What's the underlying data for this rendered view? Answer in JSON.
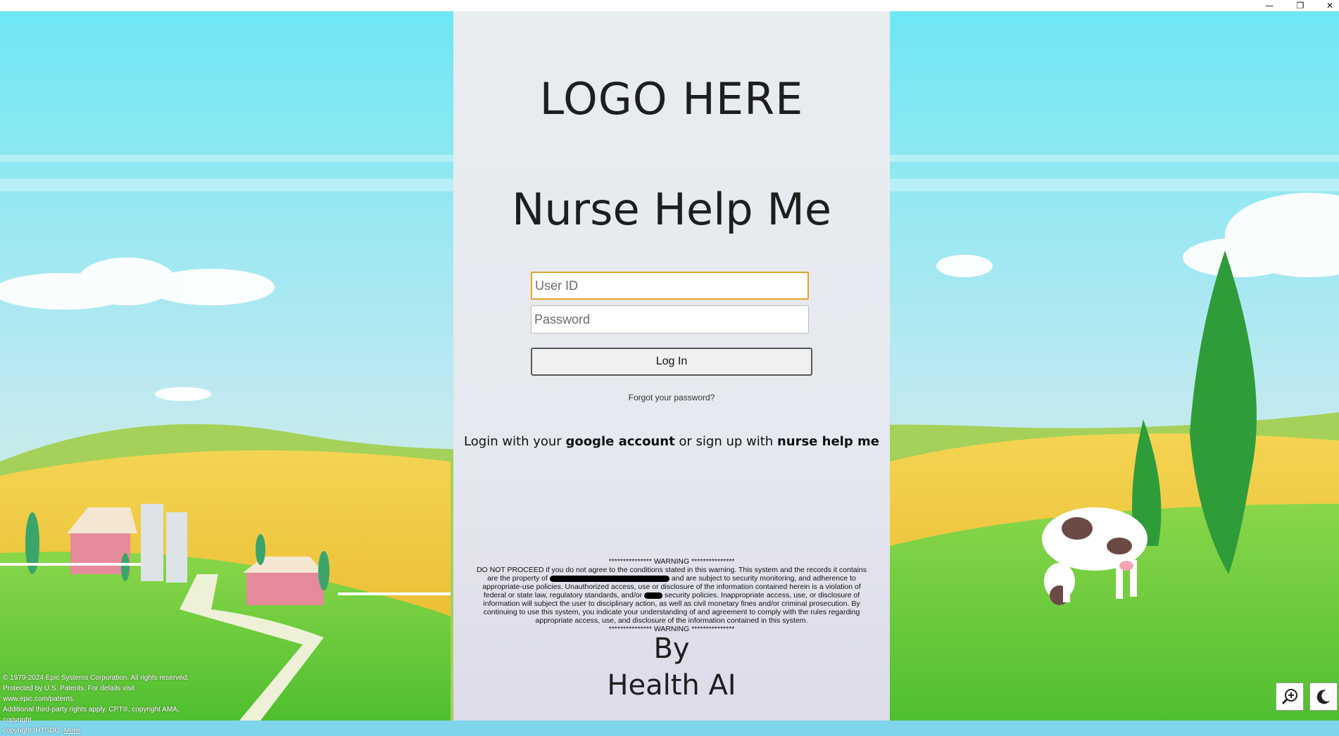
{
  "window": {
    "minimize_icon": "minimize-icon",
    "restore_icon": "restore-icon",
    "close_icon": "close-icon"
  },
  "login": {
    "logo_text": "LOGO HERE",
    "app_title": "Nurse Help Me",
    "user_id": {
      "value": "",
      "placeholder": "User ID"
    },
    "password": {
      "value": "",
      "placeholder": "Password"
    },
    "login_button": "Log In",
    "forgot_link": "Forgot your password?",
    "social": {
      "prefix": "Login with your ",
      "google": "google account",
      "middle": " or sign up with ",
      "signup": "nurse help me"
    },
    "warning": {
      "header": "*************** WARNING ***************",
      "line1": "DO NOT PROCEED if you do not agree to the conditions stated in this warning. This system and the records it contains",
      "line2a": "are the property of",
      "line2b": "and are subject to security monitoring, and adherence to",
      "line3": "appropriate-use policies. Unauthorized access, use or disclosure of the information contained herein is a violation of",
      "line4a": "federal or state law, regulatory standards, and/or",
      "line4b": "security policies. Inappropriate access, use, or disclosure of",
      "line5": "information will subject the user to disciplinary action, as well as civil monetary fines and/or criminal prosecution. By",
      "line6": "continuing to use this system, you indicate your understanding of and agreement to comply with the rules regarding",
      "line7": "appropriate access, use, and disclosure of the information contained in this system.",
      "footer": "*************** WARNING ***************"
    },
    "by_line": "By",
    "by_company": "Health AI"
  },
  "copyright": {
    "line1": "© 1979-2024 Epic Systems Corporation. All rights reserved.",
    "line2": "Protected by U.S. Patents. For details visit www.epic.com/patents.",
    "line3": "Additional third-party rights apply. CPT®, copyright AMA, copyright",
    "line4": "copyright IHTSDO.",
    "more": "More"
  },
  "corner": {
    "zoom_icon": "zoom-in-icon",
    "theme_icon": "dark-mode-moon-icon"
  },
  "colors": {
    "focus_border": "#e2a32d",
    "panel_bg": "#e8edf0",
    "sky": "#7fd6ea",
    "field_green": "#5fc93a"
  }
}
